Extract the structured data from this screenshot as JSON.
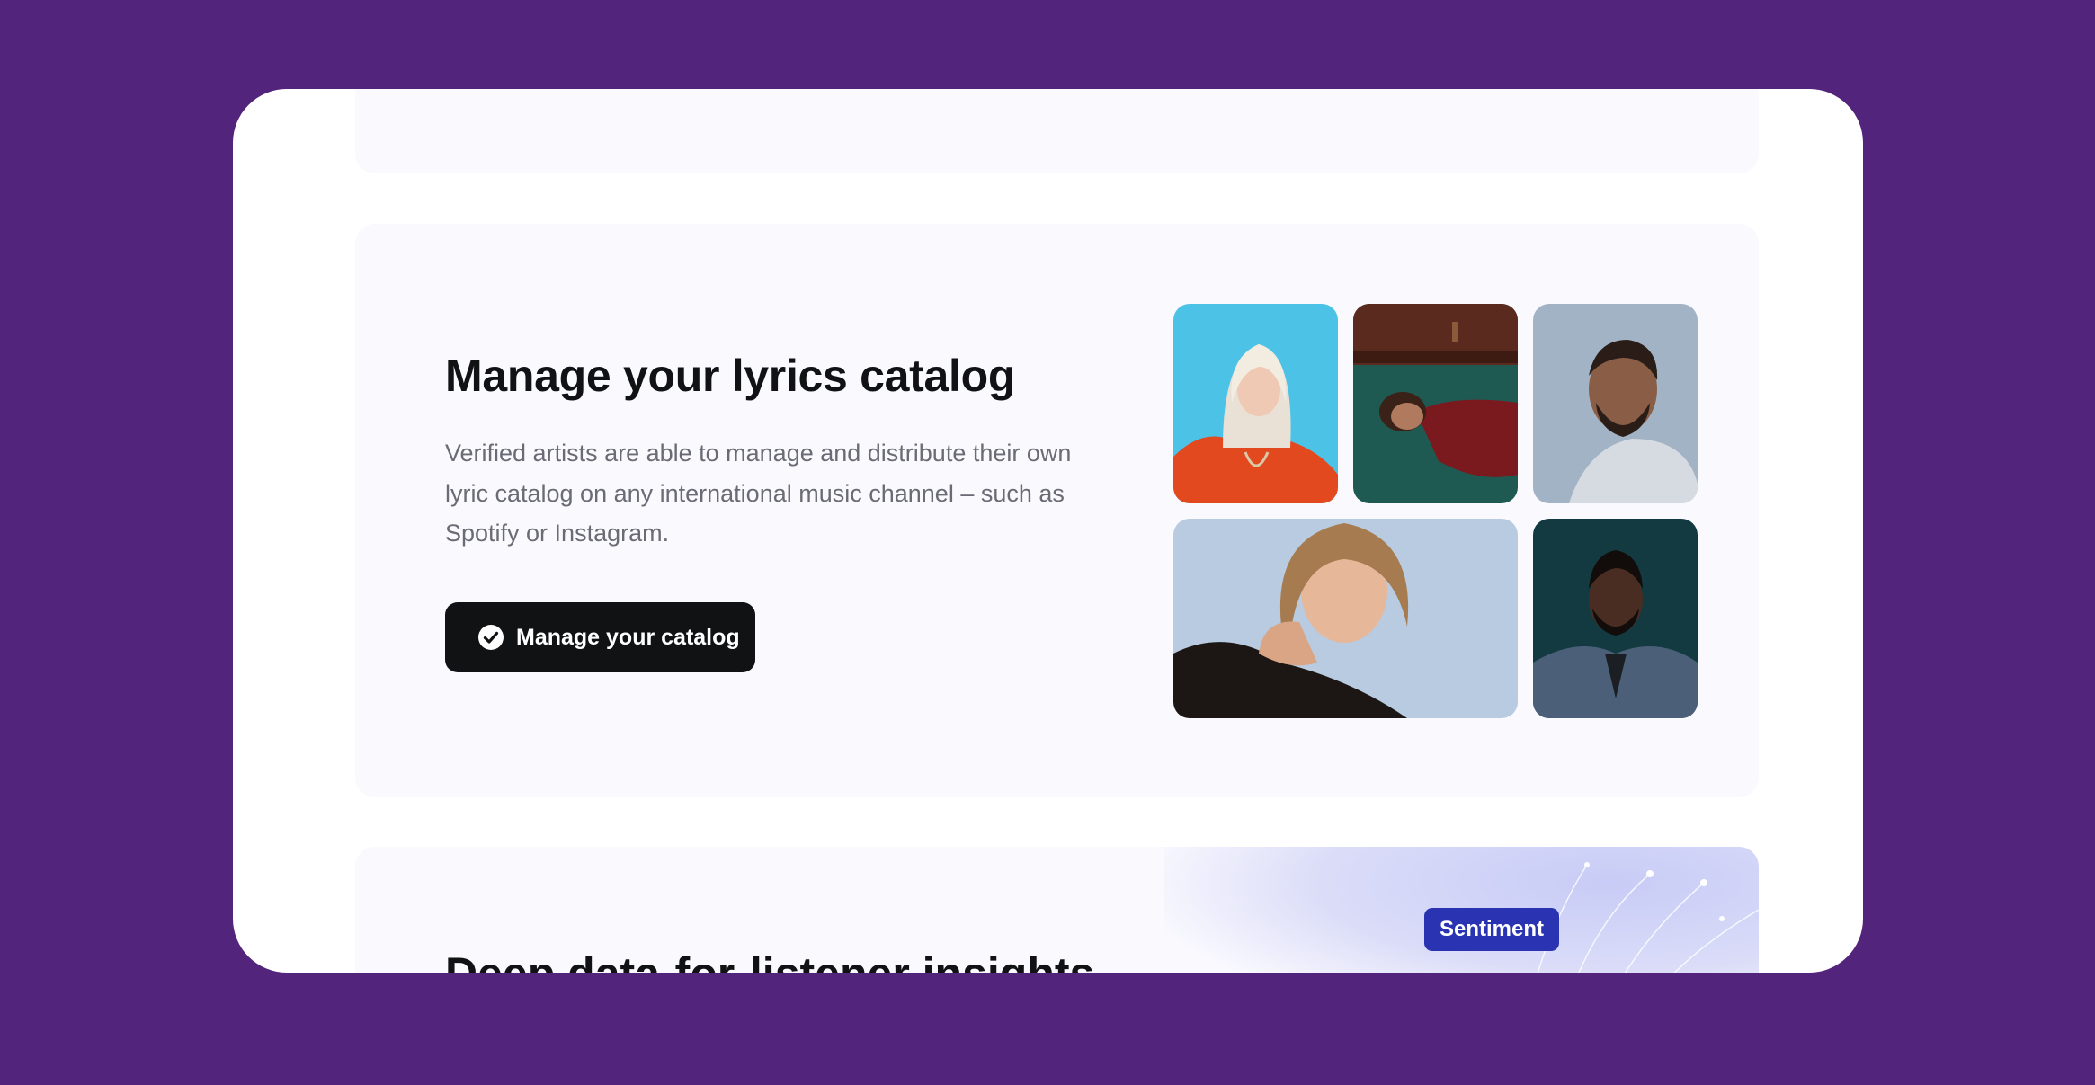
{
  "main_section": {
    "title": "Manage your lyrics catalog",
    "description": "Verified artists are able to manage and distribute their own lyric catalog on any international music channel – such as Spotify or Instagram.",
    "cta_label": "Manage your catalog",
    "cta_icon": "check-circle-icon"
  },
  "artist_photos": [
    {
      "name": "artist-photo-1",
      "dominant_color": "#4cc3e6"
    },
    {
      "name": "artist-photo-2",
      "dominant_color": "#1f5a52"
    },
    {
      "name": "artist-photo-3",
      "dominant_color": "#a3b3c6"
    },
    {
      "name": "artist-photo-4",
      "dominant_color": "#b9cbe0"
    },
    {
      "name": "artist-photo-5",
      "dominant_color": "#123a40"
    }
  ],
  "next_section": {
    "badge": "Sentiment",
    "title_partial": "Deep data-for-listener insights"
  },
  "colors": {
    "background": "#53247c",
    "card": "#f9f9fe",
    "button": "#111214",
    "badge": "#2a34b3"
  }
}
